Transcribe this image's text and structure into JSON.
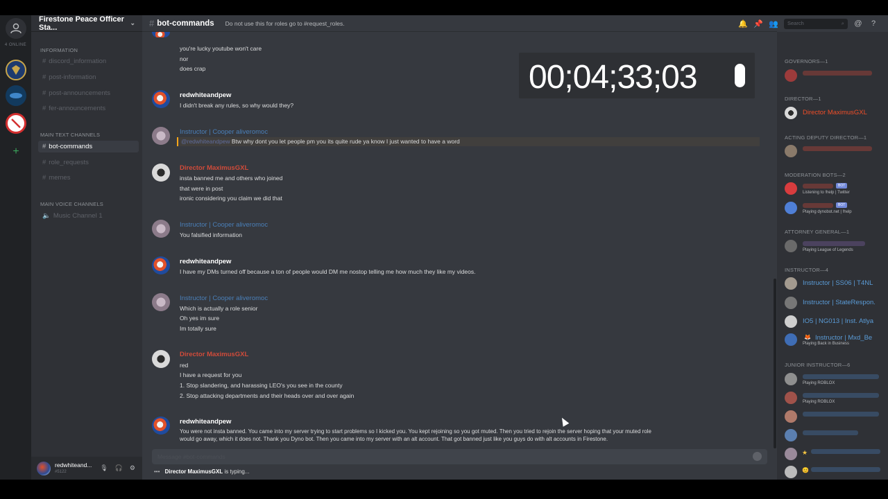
{
  "rail": {
    "label": "4 ONLINE"
  },
  "server": {
    "name": "Firestone Peace Officer Sta..."
  },
  "sidebar": {
    "categories": [
      {
        "name": "INFORMATION"
      },
      {
        "name": "MAIN TEXT CHANNELS"
      },
      {
        "name": "MAIN VOICE CHANNELS"
      }
    ],
    "info_channels": [
      "discord_information",
      "post-information",
      "post-announcements",
      "fer-announcements"
    ],
    "text_channels": [
      "bot-commands",
      "role_requests",
      "memes"
    ],
    "voice_channels": [
      "Music Channel 1"
    ]
  },
  "user": {
    "name": "redwhiteand...",
    "discriminator": "#5122"
  },
  "channel": {
    "name": "bot-commands",
    "topic": "Do not use this for roles go to #request_roles."
  },
  "search": {
    "placeholder": "Search"
  },
  "timer": {
    "text": "00;04;33;03"
  },
  "messages": {
    "first_lines": [
      "you're lucky youtube won't care",
      "nor",
      "does crap"
    ],
    "m1": {
      "author": "redwhiteandpew",
      "lines": [
        "I didn't break any rules, so why would they?"
      ]
    },
    "m2": {
      "author": "Instructor | Cooper aliveromoc",
      "mention": "@redwhiteandpew",
      "text": "Btw why dont you let people pm you its quite rude ya know I just wanted to have a word"
    },
    "m3": {
      "author": "Director MaximusGXL",
      "lines": [
        "insta banned me and others who joined",
        "that were in post",
        "ironic considering you claim we did that"
      ]
    },
    "m4": {
      "author": "Instructor | Cooper aliveromoc",
      "lines": [
        "You falsified information"
      ]
    },
    "m5": {
      "author": "redwhiteandpew",
      "lines": [
        "I have my DMs turned off because a ton of people would DM me nostop telling me how much they like my videos."
      ]
    },
    "m6": {
      "author": "Instructor | Cooper aliveromoc",
      "lines": [
        "Which is actually a role senior",
        "Oh yes im sure",
        "Im totally sure"
      ]
    },
    "m7": {
      "author": "Director MaximusGXL",
      "lines": [
        "red",
        "I have a request for you",
        "1. Stop slandering, and harassing LEO's you see in the county",
        "2. Stop attacking departments and their heads over and over again"
      ]
    },
    "m8": {
      "author": "redwhiteandpew",
      "lines": [
        "You were not insta banned. You came into my server trying to start problems so I kicked you. You kept rejoining so you got muted. Then you tried to rejoin the server hoping that your muted role",
        "would go away, which it does not. Thank you Dyno bot. Then you came into my server with an alt account. That got banned just like you guys do with alt accounts in Firestone."
      ]
    }
  },
  "input": {
    "placeholder": "Message #bot-commands"
  },
  "typing": {
    "name": "Director MaximusGXL",
    "suffix": "is typing..."
  },
  "members": {
    "cat_governors": "GOVERNORS—1",
    "cat_director": "DIRECTOR—1",
    "director_name": "Director MaximusGXL",
    "cat_acting": "ACTING DEPUTY DIRECTOR—1",
    "cat_modbots": "MODERATION BOTS—2",
    "bot1_sub": "Listening to !help | Twitter",
    "bot2_sub": "Playing dynobot.net | !help",
    "bot_tag": "BOT",
    "cat_attorney": "ATTORNEY GENERAL—1",
    "attorney_sub": "Playing League of Legends",
    "cat_instructor": "INSTRUCTOR—4",
    "instructors": [
      "Instructor | SS06 | T4NL",
      "Instructor | StateRespon.",
      "IO5 | NG013 | Inst. Atlya",
      "Instructor | Mxd_Be"
    ],
    "instructor4_sub": "Playing Back in Business",
    "cat_junior": "JUNIOR INSTRUCTOR—6",
    "junior1_sub": "Playing ROBLOX",
    "junior2_sub": "Playing ROBLOX"
  }
}
